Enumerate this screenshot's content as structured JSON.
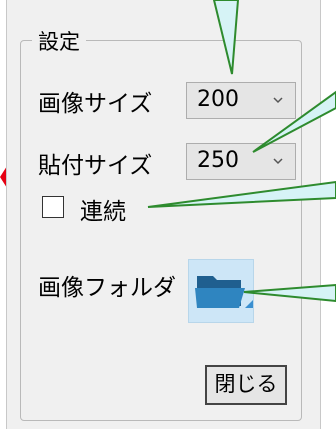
{
  "window": {
    "group_title": "設定"
  },
  "settings": {
    "image_size": {
      "label": "画像サイズ",
      "value": "200"
    },
    "paste_size": {
      "label": "貼付サイズ",
      "value": "250"
    },
    "continuous": {
      "label": "連続",
      "checked": false
    },
    "image_folder": {
      "label": "画像フォルダ",
      "icon": "folder-open-icon"
    }
  },
  "buttons": {
    "close_label": "閉じる"
  },
  "colors": {
    "callout_line": "#2e8b2e",
    "callout_fill": "#d6f3f6",
    "arrow": "#e60012"
  }
}
